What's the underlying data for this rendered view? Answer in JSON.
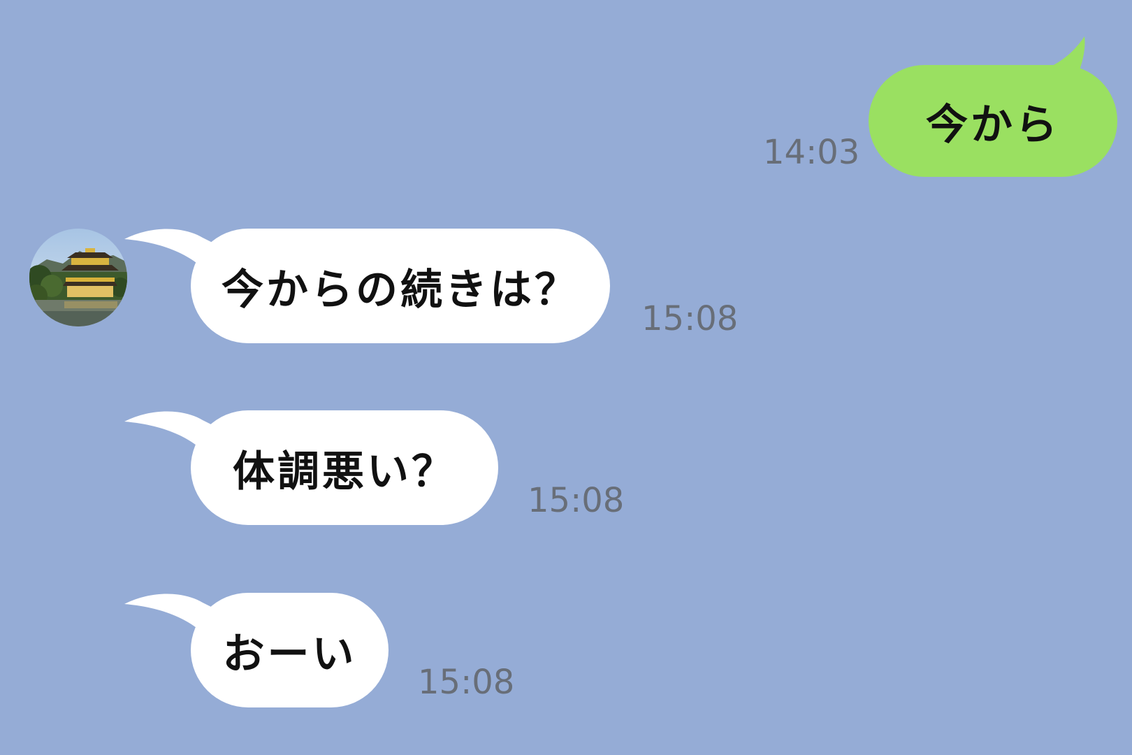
{
  "chat": {
    "background_color": "#95acd6",
    "outgoing_bubble_color": "#9ae061",
    "incoming_bubble_color": "#ffffff",
    "messages": [
      {
        "direction": "outgoing",
        "text": "今から",
        "time": "14:03"
      },
      {
        "direction": "incoming",
        "text": "今からの続きは？",
        "time": "15:08"
      },
      {
        "direction": "incoming",
        "text": "体調悪い？",
        "time": "15:08"
      },
      {
        "direction": "incoming",
        "text": "おーい",
        "time": "15:08"
      }
    ],
    "contact_avatar": {
      "icon": "golden-pavilion-photo-avatar"
    }
  }
}
